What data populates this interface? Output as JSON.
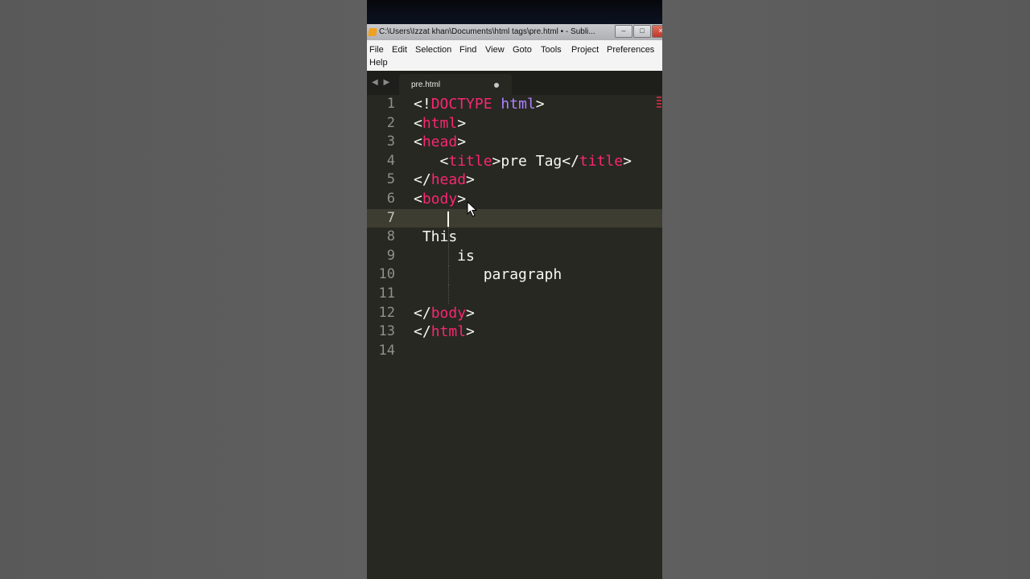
{
  "window": {
    "title": "C:\\Users\\Izzat khan\\Documents\\html tags\\pre.html • - Subli..."
  },
  "menu": {
    "file": "File",
    "edit": "Edit",
    "selection": "Selection",
    "find": "Find",
    "view": "View",
    "goto": "Goto",
    "tools": "Tools",
    "project": "Project",
    "preferences": "Preferences",
    "help": "Help"
  },
  "tab": {
    "nav": "◀ ▶",
    "filename": "pre.html"
  },
  "editor": {
    "active_line": 7,
    "lines": [
      {
        "n": "1",
        "tokens": [
          [
            "p",
            "<!"
          ],
          [
            "t",
            "DOCTYPE"
          ],
          [
            "p",
            " "
          ],
          [
            "a",
            "html"
          ],
          [
            "p",
            ">"
          ]
        ]
      },
      {
        "n": "2",
        "tokens": [
          [
            "p",
            "<"
          ],
          [
            "t",
            "html"
          ],
          [
            "p",
            ">"
          ]
        ]
      },
      {
        "n": "3",
        "tokens": [
          [
            "p",
            "<"
          ],
          [
            "t",
            "head"
          ],
          [
            "p",
            ">"
          ]
        ]
      },
      {
        "n": "4",
        "tokens": [
          [
            "p",
            "   <"
          ],
          [
            "t",
            "title"
          ],
          [
            "p",
            ">pre Tag</"
          ],
          [
            "t",
            "title"
          ],
          [
            "p",
            ">"
          ]
        ]
      },
      {
        "n": "5",
        "tokens": [
          [
            "p",
            "</"
          ],
          [
            "t",
            "head"
          ],
          [
            "p",
            ">"
          ]
        ]
      },
      {
        "n": "6",
        "tokens": [
          [
            "p",
            "<"
          ],
          [
            "t",
            "body"
          ],
          [
            "p",
            ">"
          ]
        ]
      },
      {
        "n": "7",
        "tokens": []
      },
      {
        "n": "8",
        "tokens": [
          [
            "p",
            " This"
          ]
        ]
      },
      {
        "n": "9",
        "tokens": [
          [
            "p",
            "     is"
          ]
        ]
      },
      {
        "n": "10",
        "tokens": [
          [
            "p",
            "        paragraph"
          ]
        ]
      },
      {
        "n": "11",
        "tokens": []
      },
      {
        "n": "12",
        "tokens": [
          [
            "p",
            "</"
          ],
          [
            "t",
            "body"
          ],
          [
            "p",
            ">"
          ]
        ]
      },
      {
        "n": "13",
        "tokens": [
          [
            "p",
            "</"
          ],
          [
            "t",
            "html"
          ],
          [
            "p",
            ">"
          ]
        ]
      },
      {
        "n": "14",
        "tokens": []
      }
    ]
  },
  "colors": {
    "background": "#272822",
    "tag": "#f92672",
    "attribute": "#ae81ff",
    "text": "#f8f8f2",
    "line_number": "#90908a",
    "active_line": "#3e3d32"
  },
  "icons": {
    "app": "sublime-text-icon",
    "minimize": "minimize-icon",
    "maximize": "maximize-icon",
    "close": "close-icon",
    "mouse": "mouse-pointer-icon"
  }
}
